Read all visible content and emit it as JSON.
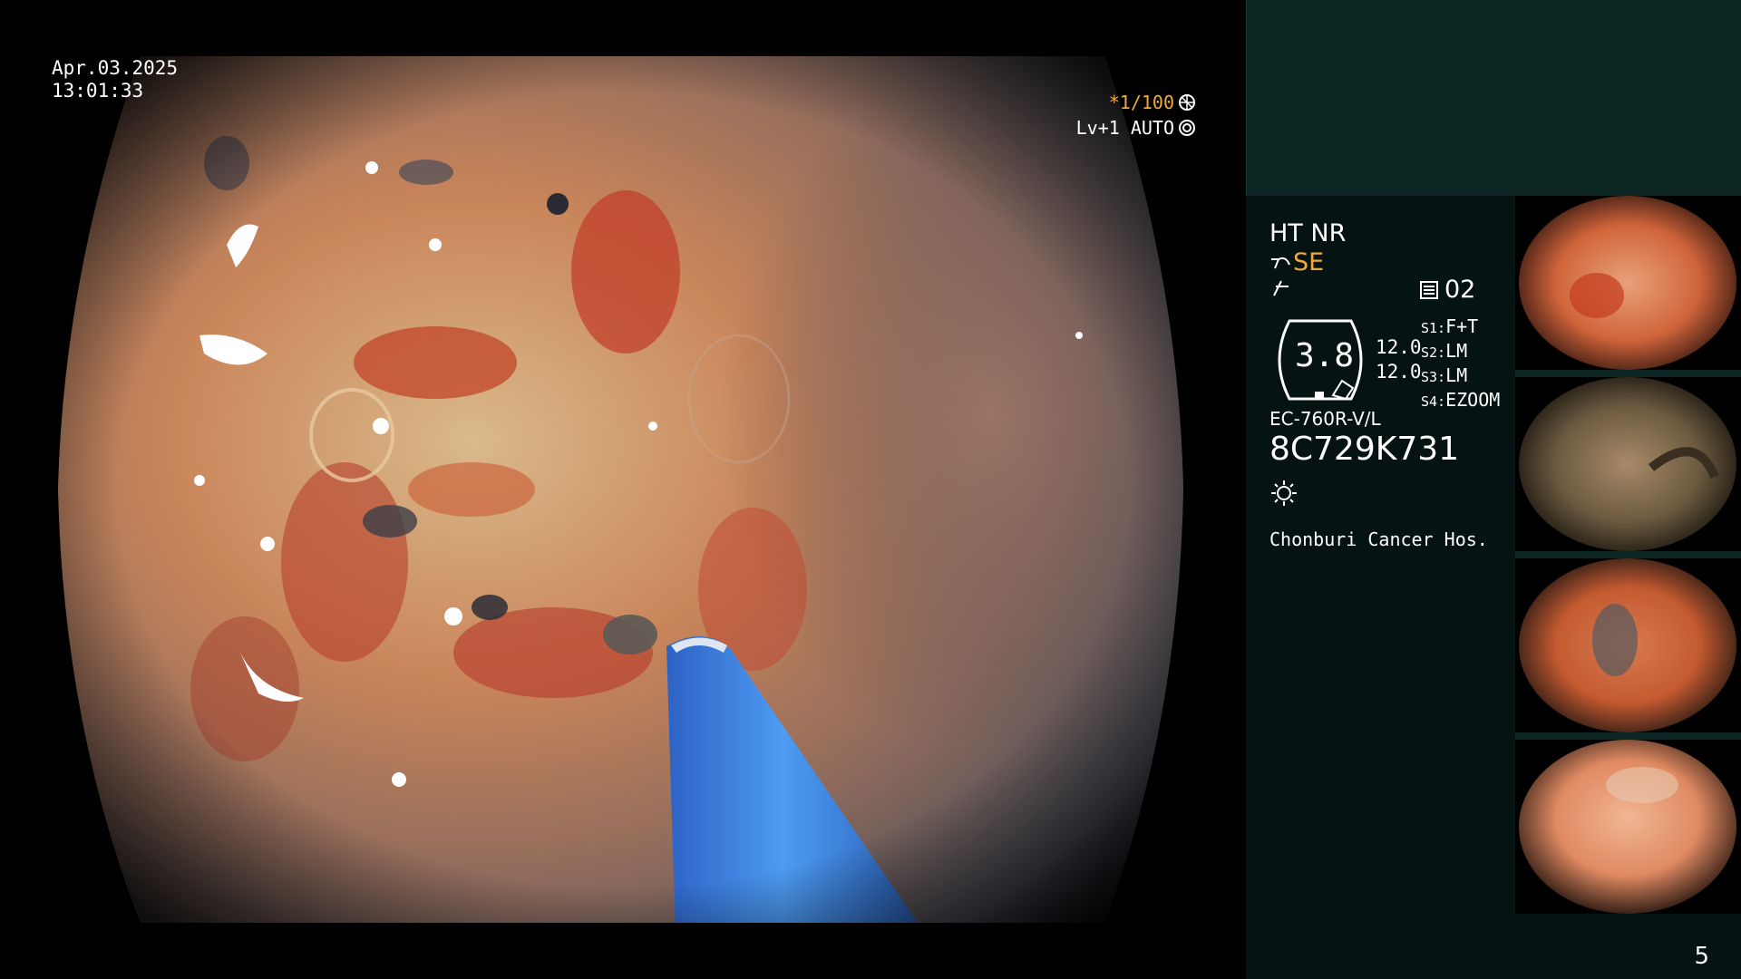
{
  "overlay": {
    "date": "Apr.03.2025",
    "time": "13:01:33",
    "shutter": "*1/100",
    "iris": "Lv+1 AUTO"
  },
  "panel": {
    "mode1": "HT NR",
    "mode2": "SE",
    "memory": "02",
    "gauge_value": "3.8",
    "scale1": "12.0",
    "scale2": "12.0",
    "switches": [
      {
        "key": "S1:",
        "value": "F+T"
      },
      {
        "key": "S2:",
        "value": "LM"
      },
      {
        "key": "S3:",
        "value": "LM"
      },
      {
        "key": "S4:",
        "value": "EZOOM"
      }
    ],
    "scope_model": "EC-760R-V/L",
    "serial": "8C729K731",
    "hospital": "Chonburi Cancer Hos."
  },
  "page_number": "5",
  "colors": {
    "panel_bg": "#051413",
    "panel_top_bg": "#0c2624",
    "accent_orange": "#f2a93b",
    "tissue": "#c98a5c",
    "instrument": "#3b82e0"
  },
  "icons": [
    "shutter-icon",
    "iris-icon",
    "enhance-icon",
    "filter-icon",
    "memory-icon",
    "light-icon"
  ]
}
